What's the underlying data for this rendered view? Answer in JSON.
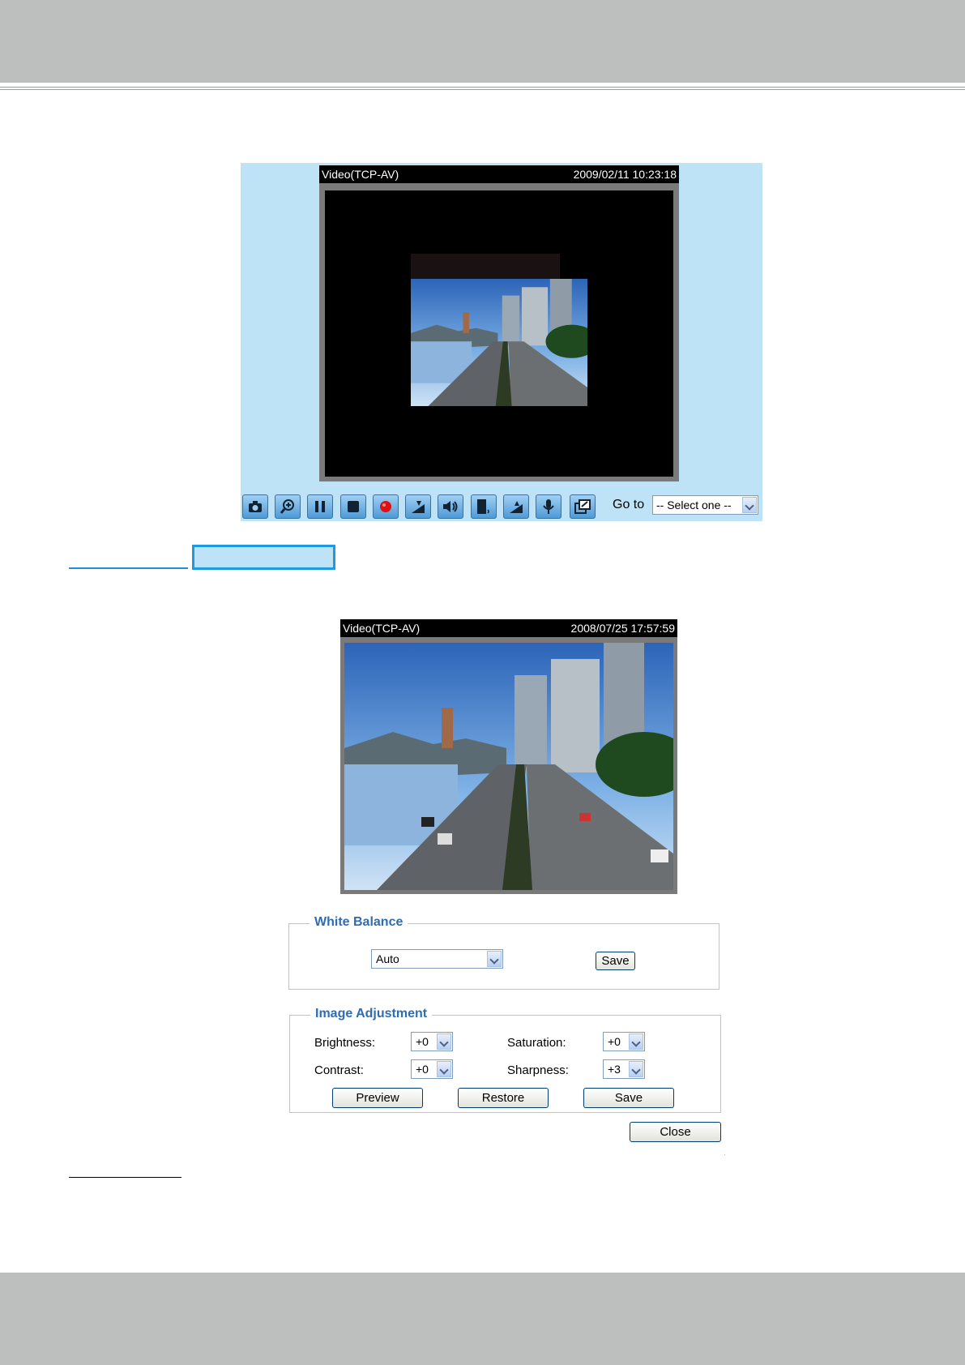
{
  "live_view": {
    "caption_left": "Video(TCP-AV)",
    "caption_right": "2009/02/11 10:23:18",
    "toolbar_icons": [
      "camera-icon",
      "zoom-icon",
      "pause-icon",
      "stop-icon",
      "record-icon",
      "volume-down-icon",
      "speaker-icon",
      "talk-icon",
      "volume-up-icon",
      "microphone-icon",
      "fullscreen-icon"
    ],
    "goto_label": "Go to",
    "goto_selected": "-- Select one --"
  },
  "image_settings": {
    "caption_left": "Video(TCP-AV)",
    "caption_right": "2008/07/25 17:57:59",
    "white_balance": {
      "legend": "White Balance",
      "mode": "Auto",
      "save_label": "Save"
    },
    "image_adjustment": {
      "legend": "Image Adjustment",
      "brightness_label": "Brightness:",
      "brightness_value": "+0",
      "saturation_label": "Saturation:",
      "saturation_value": "+0",
      "contrast_label": "Contrast:",
      "contrast_value": "+0",
      "sharpness_label": "Sharpness:",
      "sharpness_value": "+3",
      "preview_label": "Preview",
      "restore_label": "Restore",
      "save_label": "Save"
    },
    "close_label": "Close"
  },
  "colors": {
    "header_band": "#bdbfbf",
    "panel_background": "#bfe3f6",
    "legend_text": "#2e6db4",
    "highlight_border": "#1e9be0"
  }
}
